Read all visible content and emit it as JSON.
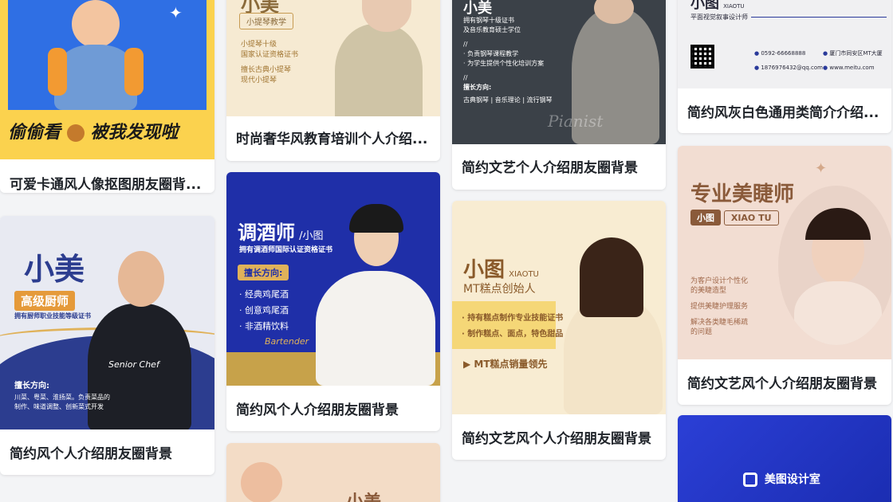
{
  "colors": {
    "card_bg": "#ffffff",
    "page_bg": "#f3f4f6",
    "title_text": "#1f2329",
    "navy": "#23347f",
    "royal_blue": "#1f2fa8",
    "gold": "#e0b25a",
    "cream": "#f7ebd6",
    "peach": "#f1d6c5"
  },
  "cards": [
    {
      "title": "可爱卡通风人像抠图朋友圈背...",
      "thumb": {
        "headline": "偷偷看",
        "headline2": "被我发现啦",
        "icon": "bear-sticker-icon",
        "sparkle_icon": "sparkle-icon"
      }
    },
    {
      "title": "简约风个人介绍朋友圈背景",
      "thumb": {
        "name": "小美",
        "role": "高级厨师",
        "cert": "拥有厨师职业技能等级证书",
        "skills_title": "擅长方向:",
        "skills_line1": "川菜、粤菜、淮扬菜。负责菜品的",
        "skills_line2": "制作、味道调整、创新菜式开发",
        "signature": "Senior Chef"
      }
    },
    {
      "title": "时尚奢华风教育培训个人介绍...",
      "thumb": {
        "name": "小美",
        "subtitle": "小提琴教学",
        "bullet1_a": "小提琴十级",
        "bullet1_b": "国家认证资格证书",
        "bullet2_a": "擅长古典小提琴",
        "bullet2_b": "现代小提琴"
      }
    },
    {
      "title": "简约风个人介绍朋友圈背景",
      "thumb": {
        "name": "调酒师",
        "name_suffix": "/小图",
        "cert": "拥有调酒师国际认证资格证书",
        "skills_title": "擅长方向:",
        "skill1": "· 经典鸡尾酒",
        "skill2": "· 创意鸡尾酒",
        "skill3": "· 非酒精饮料",
        "signature": "Bartender"
      }
    },
    {
      "title": "",
      "thumb": {
        "name": "小美"
      }
    },
    {
      "title": "简约文艺个人介绍朋友圈背景",
      "thumb": {
        "name": "小美",
        "line1": "拥有钢琴十级证书",
        "line2": "及音乐教育硕士学位",
        "slash1": "//",
        "bullet1": "· 负责钢琴课程教学",
        "bullet2": "· 为学生提供个性化培训方案",
        "slash2": "//",
        "skills_title": "擅长方向:",
        "skills": "古典钢琴  |  音乐理论  |  流行钢琴",
        "signature": "Pianist"
      }
    },
    {
      "title": "简约文艺风个人介绍朋友圈背景",
      "thumb": {
        "name": "小图",
        "name_en": "XIAOTU",
        "role": "MT糕点创始人",
        "bullet1": "· 持有糕点制作专业技能证书",
        "bullet2": "· 制作糕点、面点，特色甜品",
        "highlight": "▶ MT糕点销量领先"
      }
    },
    {
      "title": "简约风灰白色通用类简介介绍...",
      "thumb": {
        "name": "小图",
        "name_en": "XIAOTU",
        "role": "平面视觉叙事设计师",
        "phone": "0592-66668888",
        "address": "厦门市同安区MT大厦",
        "email": "1876976432@qq.com",
        "website": "www.meitu.com"
      }
    },
    {
      "title": "简约文艺风个人介绍朋友圈背景",
      "thumb": {
        "headline": "专业美睫师",
        "name": "小图",
        "name_en": "XIAO TU",
        "bullet1_a": "为客户设计个性化",
        "bullet1_b": "的美睫造型",
        "bullet2": "提供美睫护理服务",
        "bullet3_a": "解决各类睫毛稀疏",
        "bullet3_b": "的问题"
      }
    },
    {
      "title": "",
      "thumb": {
        "brand": "美图设计室",
        "icon": "meitu-logo-icon"
      }
    }
  ]
}
